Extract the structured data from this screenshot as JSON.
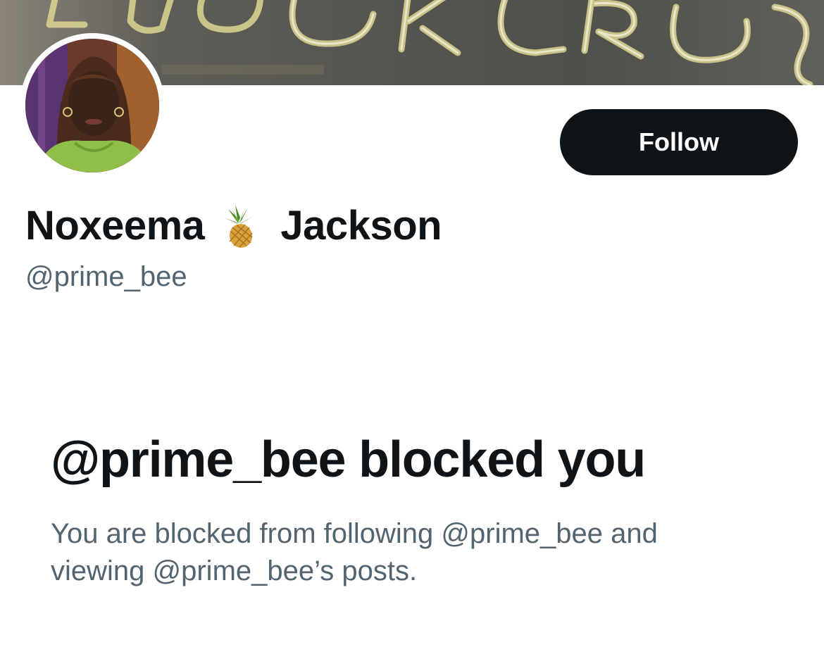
{
  "profile": {
    "display_name_first": "Noxeema",
    "display_name_emoji": "pineapple-emoji",
    "display_name_last": "Jackson",
    "handle": "@prime_bee",
    "banner_image": "banner-photo",
    "avatar_image": "avatar-photo"
  },
  "actions": {
    "follow_label": "Follow"
  },
  "blocked_notice": {
    "title": "@prime_bee blocked you",
    "description": "You are blocked from following @prime_bee and viewing @prime_bee’s posts."
  },
  "colors": {
    "text_primary": "#0f1419",
    "text_secondary": "#536471",
    "button_bg": "#0f1419",
    "button_text": "#ffffff",
    "background": "#ffffff"
  }
}
